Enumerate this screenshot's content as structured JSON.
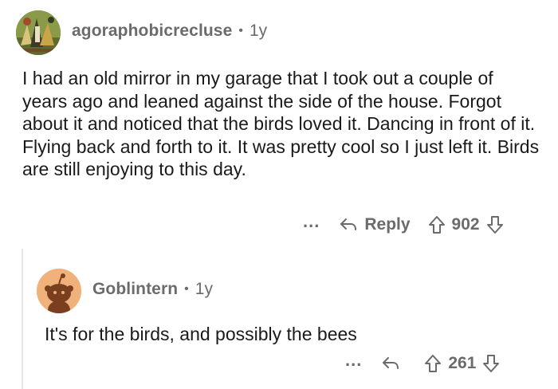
{
  "comments": [
    {
      "username": "agoraphobicrecluse",
      "separator": "•",
      "age": "1y",
      "text": "I had an old mirror in my garage that I took out a couple of years ago and leaned against the side of the house. Forgot about it and noticed that the birds loved it. Dancing in front of it. Flying back and forth to it. It was pretty cool so I just left it. Birds are still enjoying to this day.",
      "more_label": "...",
      "reply_label": "Reply",
      "score": "902",
      "icons": {
        "more": "ellipsis-icon",
        "reply": "reply-arrow-icon",
        "upvote": "upvote-arrow-icon",
        "downvote": "downvote-arrow-icon"
      }
    },
    {
      "username": "Goblintern",
      "separator": "•",
      "age": "1y",
      "text": "It's for the birds, and possibly the bees",
      "more_label": "...",
      "score": "261",
      "icons": {
        "more": "ellipsis-icon",
        "reply": "reply-arrow-icon",
        "upvote": "upvote-arrow-icon",
        "downvote": "downvote-arrow-icon"
      }
    }
  ],
  "colors": {
    "text": "#1a1a1b",
    "muted": "#6b6b6b",
    "thread_line": "#e6e6e6",
    "avatar2_bg": "#f0b27a"
  }
}
